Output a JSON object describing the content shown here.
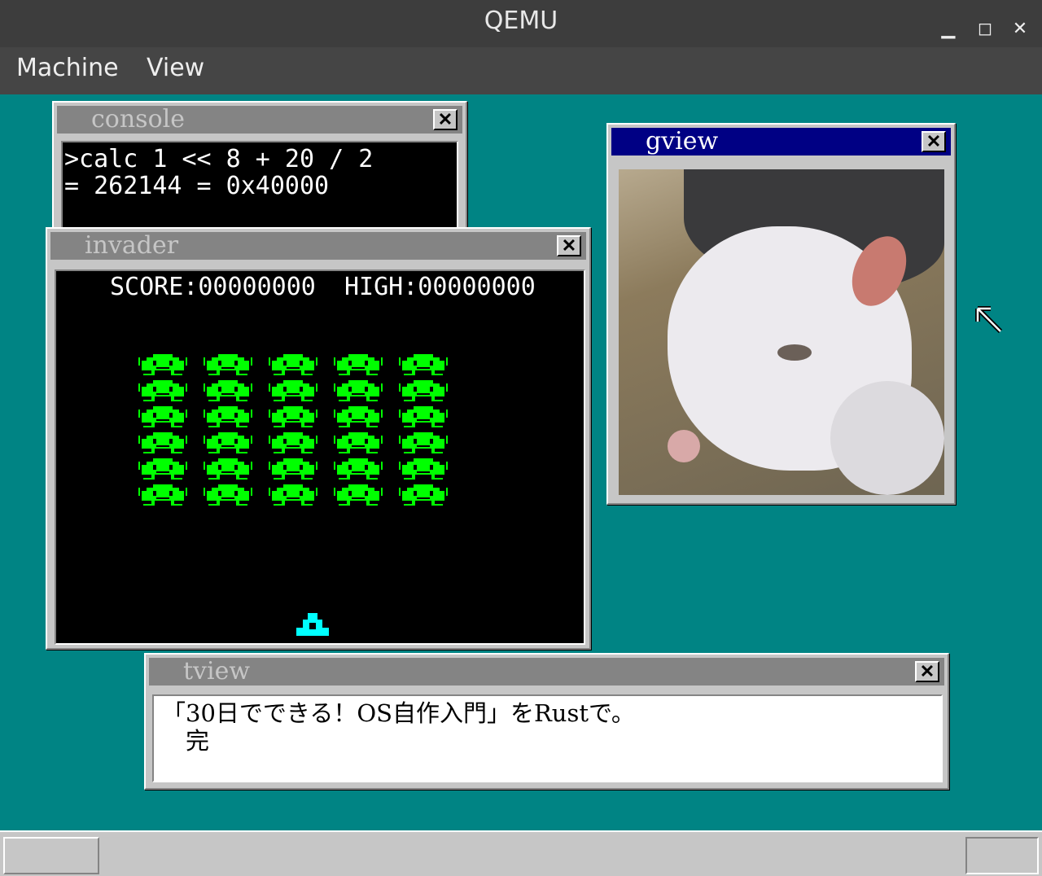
{
  "app": {
    "title": "QEMU",
    "menu": [
      "Machine",
      "View"
    ],
    "controls": {
      "minimize": "minimize-icon",
      "maximize": "maximize-icon",
      "close": "close-icon"
    }
  },
  "console": {
    "title": "console",
    "lines": [
      ">calc 1 << 8 + 20 / 2",
      "= 262144 = 0x40000"
    ]
  },
  "invader": {
    "title": "invader",
    "score_label": "SCORE:00000000",
    "high_label": "HIGH:00000000",
    "rows": 6,
    "cols": 5,
    "invader_color": "#00ff00",
    "ship_color": "#00ffff"
  },
  "gview": {
    "title": "gview"
  },
  "tview": {
    "title": "tview",
    "lines": [
      "「30日でできる！OS自作入門」をRustで。",
      "　完"
    ]
  },
  "colors": {
    "desktop": "#008484",
    "window": "#c6c6c6",
    "active_title": "#000084",
    "inactive_title": "#848484"
  }
}
